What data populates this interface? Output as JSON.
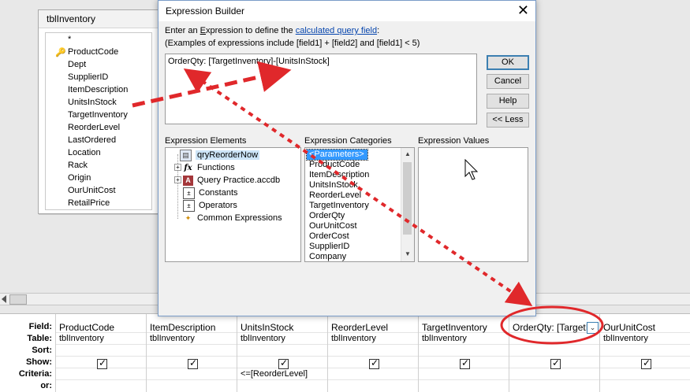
{
  "table_box": {
    "title": "tblInventory",
    "fields": [
      "*",
      "ProductCode",
      "Dept",
      "SupplierID",
      "ItemDescription",
      "UnitsInStock",
      "TargetInventory",
      "ReorderLevel",
      "LastOrdered",
      "Location",
      "Rack",
      "Origin",
      "OurUnitCost",
      "RetailPrice"
    ]
  },
  "grid": {
    "row_labels": [
      "Field:",
      "Table:",
      "Sort:",
      "Show:",
      "Criteria:",
      "or:"
    ],
    "columns": [
      {
        "field": "ProductCode",
        "table": "tblInventory",
        "show": true,
        "criteria": ""
      },
      {
        "field": "ItemDescription",
        "table": "tblInventory",
        "show": true,
        "criteria": ""
      },
      {
        "field": "UnitsInStock",
        "table": "tblInventory",
        "show": true,
        "criteria": "<=[ReorderLevel]"
      },
      {
        "field": "ReorderLevel",
        "table": "tblInventory",
        "show": true,
        "criteria": ""
      },
      {
        "field": "TargetInventory",
        "table": "tblInventory",
        "show": true,
        "criteria": ""
      },
      {
        "field": "OrderQty: [TargetIn",
        "table": "",
        "show": true,
        "criteria": ""
      },
      {
        "field": "OurUnitCost",
        "table": "tblInventory",
        "show": true,
        "criteria": ""
      }
    ]
  },
  "dialog": {
    "title": "Expression Builder",
    "close_glyph": "✕",
    "instruction_prefix": "Enter an ",
    "instruction_e": "E",
    "instruction_mid": "xpression to define the ",
    "instruction_link": "calculated query field",
    "instruction_suffix": ":",
    "examples": "(Examples of expressions include [field1] + [field2] and [field1] < 5)",
    "expression": "OrderQty: [TargetInventory]-[UnitsInStock]",
    "buttons": {
      "ok": "OK",
      "cancel": "Cancel",
      "help": "Help",
      "less": "<< Less"
    },
    "elements_label": "Expression Elements",
    "categories_label": "Expression Categories",
    "values_label": "Expression Values",
    "elements": [
      "qryReorderNow",
      "Functions",
      "Query Practice.accdb",
      "Constants",
      "Operators",
      "Common Expressions"
    ],
    "categories": [
      "<Parameters>",
      "ProductCode",
      "ItemDescription",
      "UnitsInStock",
      "ReorderLevel",
      "TargetInventory",
      "OrderQty",
      "OurUnitCost",
      "OrderCost",
      "SupplierID",
      "Company"
    ]
  },
  "colors": {
    "annotation_red": "#e0282b",
    "selection_blue": "#3399ff"
  },
  "icons": [
    "key-icon",
    "query-icon",
    "functions-icon",
    "database-icon",
    "constants-icon",
    "operators-icon",
    "common-expressions-icon",
    "close-icon",
    "dropdown-arrow-icon",
    "mouse-cursor-icon"
  ]
}
